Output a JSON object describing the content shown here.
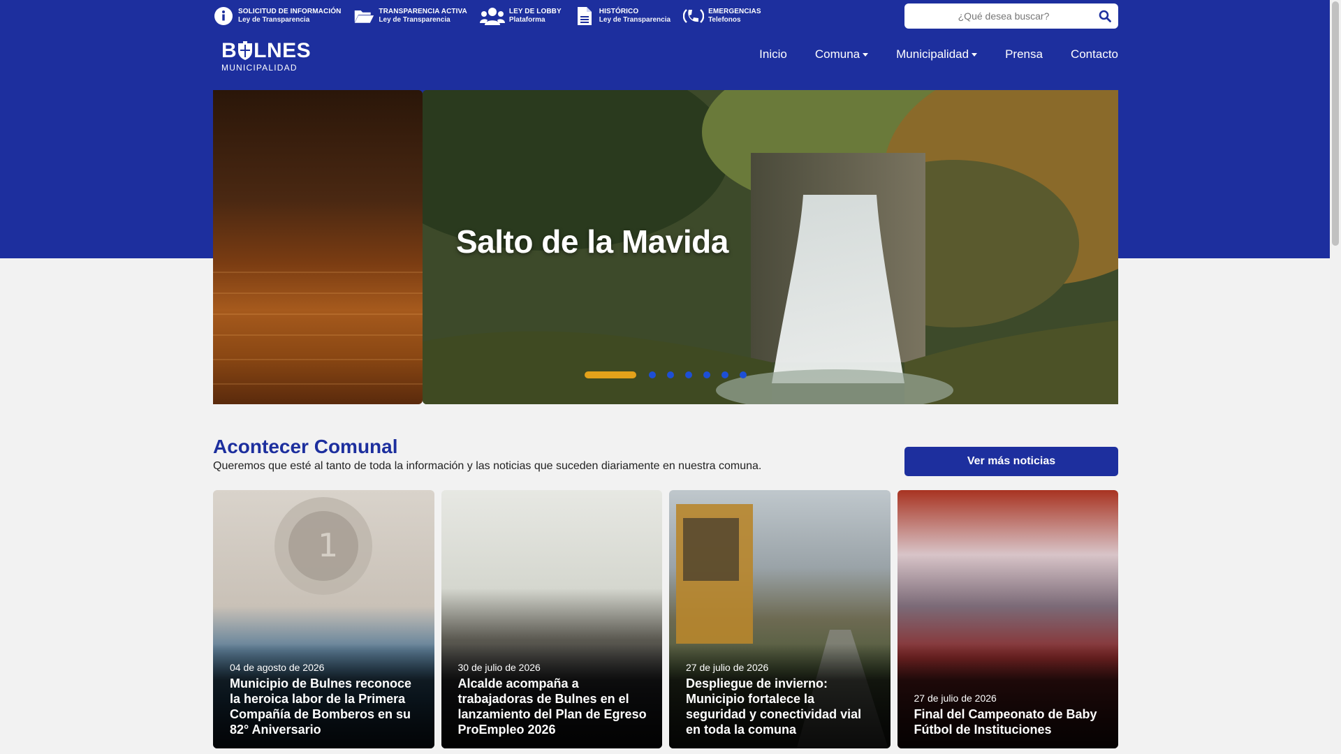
{
  "header": {
    "quick_links": [
      {
        "title": "SOLICITUD DE INFORMACIÓN",
        "subtitle": "Ley de Transparencia",
        "icon": "info-icon"
      },
      {
        "title": "TRANSPARENCIA ACTIVA",
        "subtitle": "Ley de Transparencia",
        "icon": "folder-open-icon"
      },
      {
        "title": "LEY DE LOBBY",
        "subtitle": "Plataforma",
        "icon": "users-icon"
      },
      {
        "title": "HISTÓRICO",
        "subtitle": "Ley de Transparencia",
        "icon": "document-icon"
      },
      {
        "title": "EMERGENCIAS",
        "subtitle": "Telefonos",
        "icon": "phone-signal-icon"
      }
    ],
    "search": {
      "placeholder": "¿Qué desea buscar?",
      "value": ""
    },
    "logo": {
      "word": "BULNES",
      "word_left": "B",
      "word_right": "LNES",
      "sub": "MUNICIPALIDAD"
    },
    "nav": [
      {
        "label": "Inicio",
        "dropdown": false
      },
      {
        "label": "Comuna",
        "dropdown": true
      },
      {
        "label": "Municipalidad",
        "dropdown": true
      },
      {
        "label": "Prensa",
        "dropdown": false
      },
      {
        "label": "Contacto",
        "dropdown": false
      }
    ]
  },
  "hero": {
    "title": "Salto de la Mavida",
    "slide_count": 7,
    "active_slide": 0
  },
  "news": {
    "title": "Acontecer Comunal",
    "subtitle": "Queremos que esté al tanto de toda la información y las noticias que suceden diariamente en nuestra comuna.",
    "more_label": "Ver más noticias",
    "items": [
      {
        "date": "04 de agosto de 2026",
        "headline": "Municipio de Bulnes reconoce la heroica labor de la Primera Compañía de Bomberos en su 82° Aniversario"
      },
      {
        "date": "30 de julio de 2026",
        "headline": "Alcalde acompaña a trabajadoras de Bulnes en el lanzamiento del Plan de Egreso ProEmpleo 2026"
      },
      {
        "date": "27 de julio de 2026",
        "headline": "Despliegue de invierno: Municipio fortalece la seguridad y conectividad vial en toda la comuna"
      },
      {
        "date": "27 de julio de 2026",
        "headline": "Final del Campeonato de Baby Fútbol de Instituciones"
      }
    ]
  },
  "colors": {
    "brand": "#1d2f9e",
    "accent": "#e3a21a",
    "dot": "#1d4fd6"
  }
}
